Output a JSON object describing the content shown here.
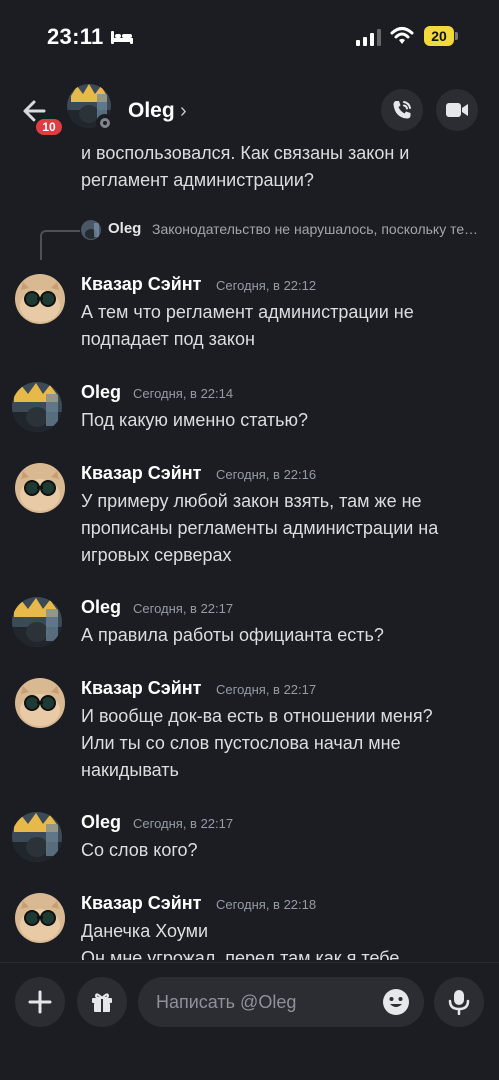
{
  "status_bar": {
    "time": "23:11",
    "battery": "20"
  },
  "header": {
    "name": "Oleg",
    "chevron": "›",
    "unread_badge": "10"
  },
  "chat": {
    "top_partial_lines": [
      "и воспользовался. Как связаны закон и",
      "регламент администрации?"
    ],
    "reply": {
      "author": "Oleg",
      "text": "Законодательство не нарушалось, поскольку тебе была дана возможность отказать..."
    },
    "messages": [
      {
        "author": "Квазар Сэйнт",
        "timestamp": "Сегодня, в 22:12",
        "lines": [
          "А тем что регламент администрации не",
          "подпадает под закон"
        ]
      },
      {
        "author": "Oleg",
        "timestamp": "Сегодня, в 22:14",
        "lines": [
          "Под какую именно статью?"
        ]
      },
      {
        "author": "Квазар Сэйнт",
        "timestamp": "Сегодня, в 22:16",
        "lines": [
          "У примеру любой закон взять, там же не",
          "прописаны регламенты администрации на",
          "игровых серверах"
        ]
      },
      {
        "author": "Oleg",
        "timestamp": "Сегодня, в 22:17",
        "lines": [
          "А правила работы официанта есть?"
        ]
      },
      {
        "author": "Квазар Сэйнт",
        "timestamp": "Сегодня, в 22:17",
        "lines": [
          "И вообще док-ва есть в отношении меня?",
          "Или ты со слов пустослова начал мне",
          "накидывать"
        ]
      },
      {
        "author": "Oleg",
        "timestamp": "Сегодня, в 22:17",
        "lines": [
          "Со слов кого?"
        ]
      },
      {
        "author": "Квазар Сэйнт",
        "timestamp": "Сегодня, в 22:18",
        "lines": [
          "Данечка Хоуми",
          "Он мне угрожал, перед там как я тебе"
        ]
      }
    ]
  },
  "composer": {
    "placeholder": "Написать @Oleg"
  },
  "icons": {
    "back": "arrow-left-icon",
    "call": "phone-call-icon",
    "video": "video-camera-icon",
    "plus": "plus-icon",
    "gift": "gift-icon",
    "emoji": "emoji-icon",
    "mic": "microphone-icon"
  },
  "colors": {
    "background": "#1c1d22",
    "badge": "#e23c42",
    "battery": "#f3d93c",
    "timestamp": "#949ba4"
  }
}
